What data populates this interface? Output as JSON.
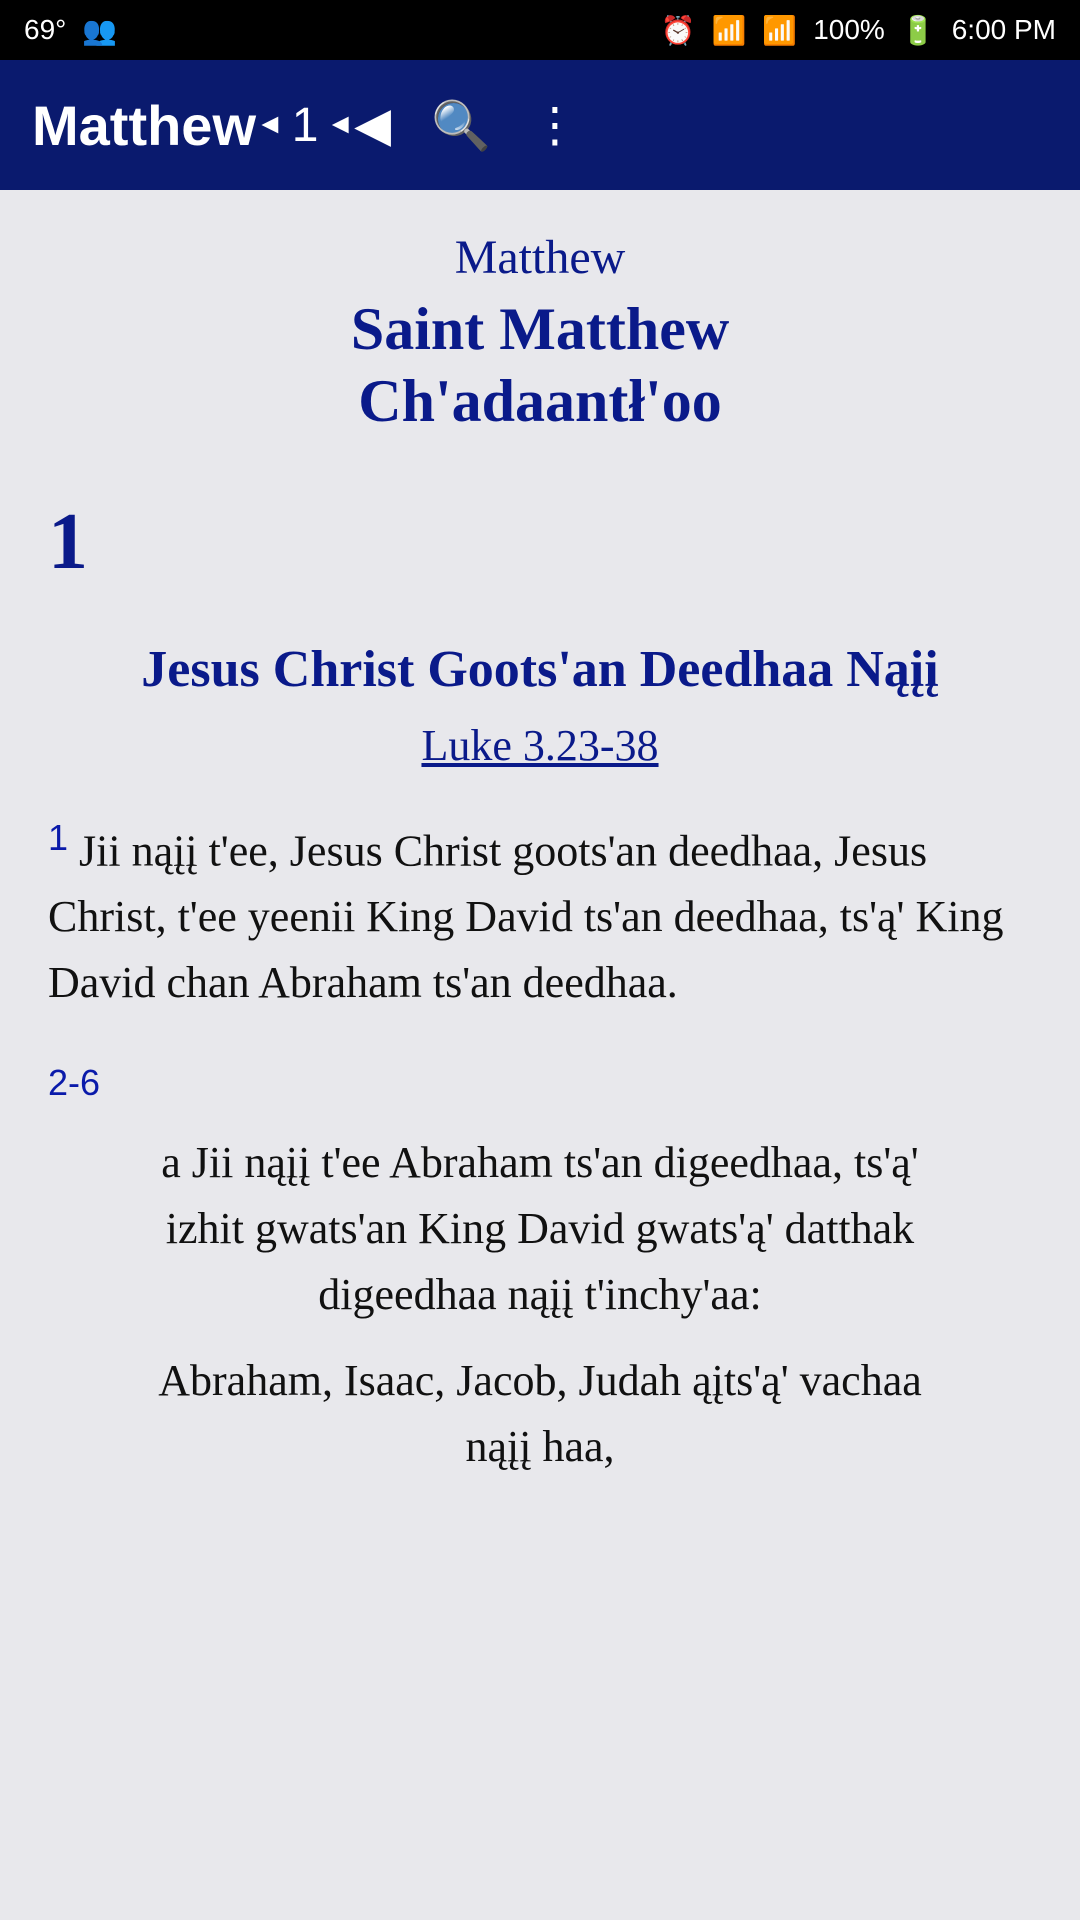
{
  "statusBar": {
    "temperature": "69°",
    "signal": "100%",
    "time": "6:00 PM"
  },
  "toolbar": {
    "title": "Matthew",
    "chapter": "1",
    "mute_label": "🔇",
    "search_label": "🔍",
    "more_label": "⋮"
  },
  "content": {
    "book_name": "Matthew",
    "subtitle_line1": "Saint Matthew",
    "subtitle_line2": "Ch'adaantł'oo",
    "chapter_number": "1",
    "section_heading": "Jesus Christ Goots'an Deedhaa Nąįį",
    "cross_reference": "Luke 3.23-38",
    "verse1_num": "1",
    "verse1_text": "Jii nąįį t'ee, Jesus Christ goots'an deedhaa, Jesus Christ, t'ee yeenii King David ts'an deedhaa, ts'ą' King David chan Abraham ts'an deedhaa.",
    "verse2_num": "2-6",
    "verse2_text_intro": "a Jii nąįį t'ee Abraham ts'an digeedhaa, ts'ą' izhit gwats'an King David gwats'ą' datthak digeedhaa nąįį t'inchy'aa:",
    "verse2_text_list": "Abraham, Isaac, Jacob, Judah ąįts'ą' vachaa nąįį haa,"
  }
}
